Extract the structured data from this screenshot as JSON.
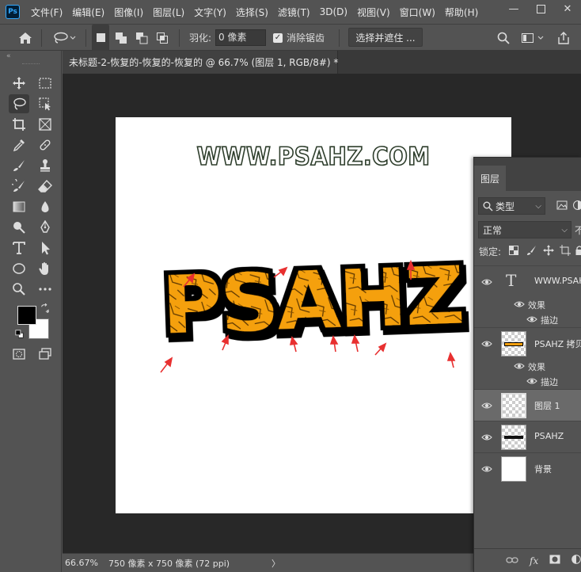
{
  "app": {
    "logo": "Ps",
    "menus": [
      "文件(F)",
      "编辑(E)",
      "图像(I)",
      "图层(L)",
      "文字(Y)",
      "选择(S)",
      "滤镜(T)",
      "3D(D)",
      "视图(V)",
      "窗口(W)",
      "帮助(H)"
    ],
    "window_controls": [
      "minimize-icon",
      "maximize-icon",
      "close-icon"
    ]
  },
  "options": {
    "feather_label": "羽化:",
    "feather_value": "0 像素",
    "antialias_label": "消除锯齿",
    "antialias_checked": true,
    "select_mask_label": "选择并遮住 ..."
  },
  "document": {
    "tab_title": "未标题-2-恢复的-恢复的-恢复的 @ 66.7% (图层 1, RGB/8#) *",
    "close_glyph": "×",
    "canvas": {
      "watermark": "WWW.PSAHZ.COM",
      "title_text": "PSAHZ",
      "fill_color": "#f5a00f",
      "stroke_color": "#000000",
      "arrow_color": "#e83030",
      "background": "#ffffff"
    }
  },
  "status": {
    "zoom": "66.67%",
    "doc_info": "750 像素 x 750 像素 (72 ppi)",
    "arrow": "〉"
  },
  "toolbar": {
    "collapse_glyph": "«",
    "tools": [
      "move-tool",
      "marquee-tool",
      "lasso-tool",
      "object-select-tool",
      "crop-tool",
      "frame-tool",
      "eyedropper-tool",
      "healing-brush-tool",
      "brush-tool",
      "clone-stamp-tool",
      "history-brush-tool",
      "eraser-tool",
      "gradient-tool",
      "blur-tool",
      "dodge-tool",
      "pen-tool",
      "type-tool",
      "path-select-tool",
      "ellipse-tool",
      "hand-tool",
      "zoom-tool",
      "more-tools"
    ],
    "active_tool": "lasso-tool",
    "foreground_color": "#000000",
    "background_color": "#ffffff"
  },
  "layers_panel": {
    "tab_label": "图层",
    "filter_label": "类型",
    "blend_mode": "正常",
    "opacity_label_partial": "不",
    "lock_label": "锁定:",
    "layers": [
      {
        "name": "WWW.PSAHZ...",
        "kind": "text",
        "visible": true,
        "effects_label": "效果",
        "effects": [
          "描边"
        ]
      },
      {
        "name": "PSAHZ 拷贝",
        "kind": "raster",
        "visible": true,
        "effects_label": "效果",
        "effects": [
          "描边"
        ]
      },
      {
        "name": "图层 1",
        "kind": "raster",
        "visible": true,
        "selected": true
      },
      {
        "name": "PSAHZ",
        "kind": "raster",
        "visible": true
      },
      {
        "name": "背景",
        "kind": "background",
        "visible": true
      }
    ],
    "footer_icons": [
      "link-icon",
      "fx-icon",
      "mask-icon",
      "adjustment-icon"
    ],
    "footer_fx": "fx"
  }
}
